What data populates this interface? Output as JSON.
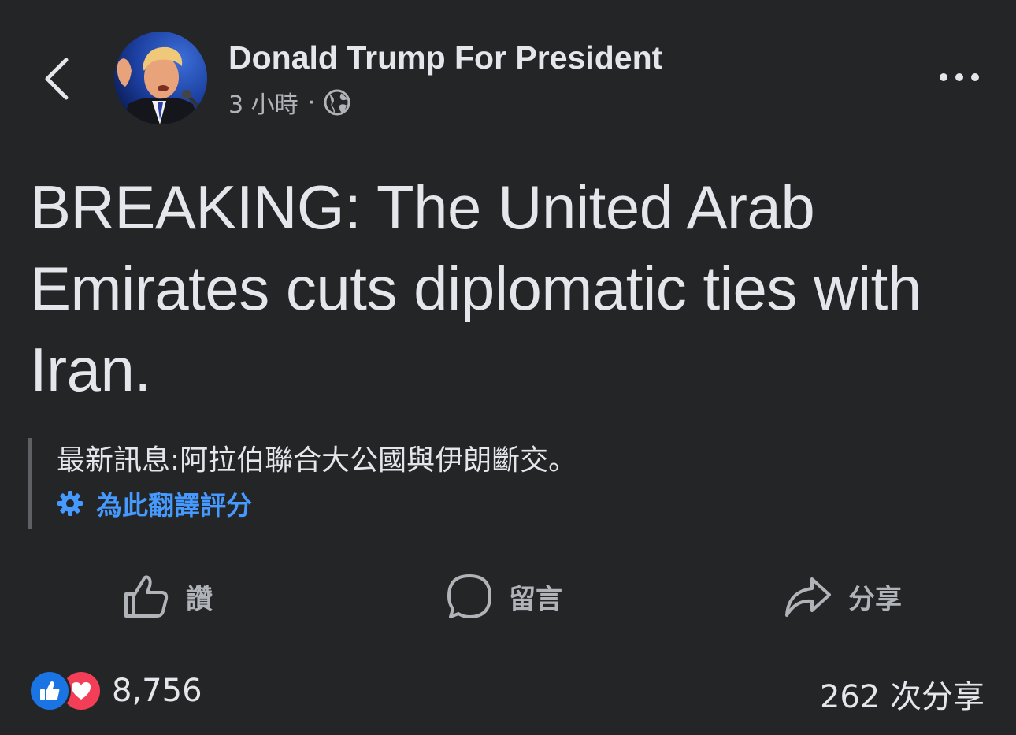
{
  "header": {
    "page_name": "Donald Trump For President",
    "time_ago": "3 小時",
    "separator": "·",
    "privacy_icon": "globe-icon",
    "back_icon": "chevron-left-icon",
    "more_icon": "more-horizontal-icon"
  },
  "post": {
    "text": "BREAKING: The United Arab Emirates cuts diplomatic ties with Iran.",
    "translation": "最新訊息:阿拉伯聯合大公國與伊朗斷交。",
    "rate_translation_label": "為此翻譯評分",
    "rate_icon": "gear-icon"
  },
  "actions": {
    "like_label": "讚",
    "comment_label": "留言",
    "share_label": "分享"
  },
  "footer": {
    "reaction_count": "8,756",
    "share_count": "262 次分享"
  },
  "colors": {
    "background": "#242526",
    "text_primary": "#e4e6eb",
    "text_secondary": "#b0b3b8",
    "link_blue": "#4599ff",
    "like_blue": "#1b74e4",
    "love_red": "#f33e58"
  }
}
